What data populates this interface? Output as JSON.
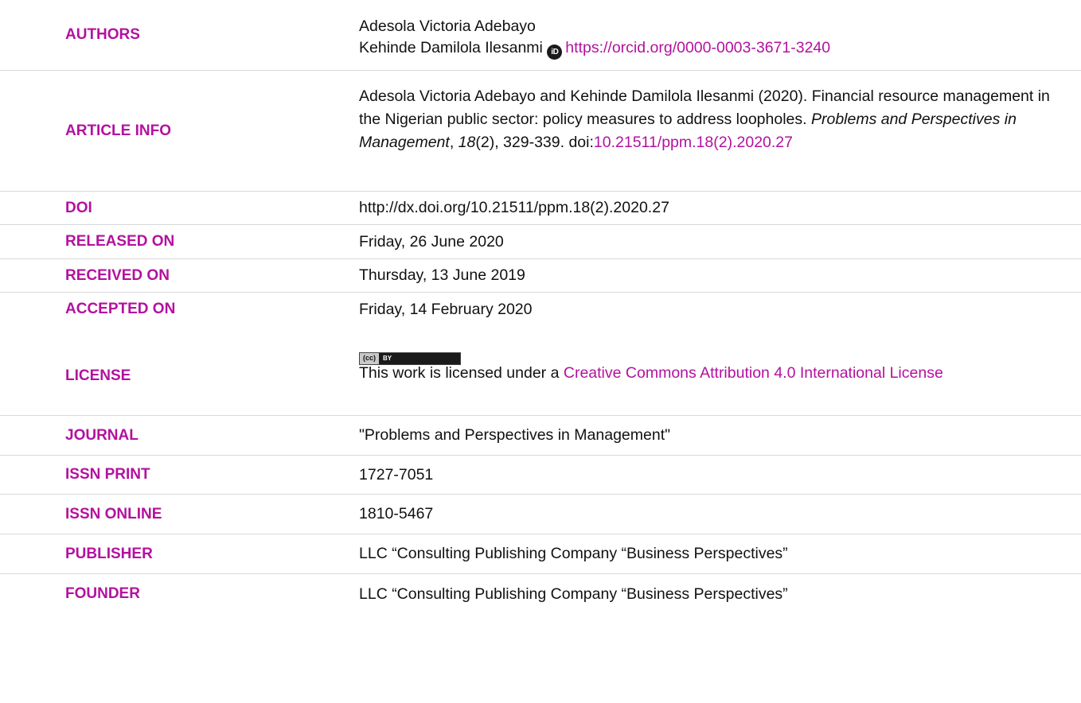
{
  "colors": {
    "label": "#b3119f",
    "link": "#b3119f",
    "divider": "#d9d9d9"
  },
  "authors": {
    "label": "AUTHORS",
    "author1": "Adesola Victoria Adebayo",
    "author2": "Kehinde Damilola Ilesanmi",
    "orcid_icon_text": "iD",
    "orcid_url": "https://orcid.org/0000-0003-3671-3240"
  },
  "article_info": {
    "label": "ARTICLE INFO",
    "citation_part1": "Adesola Victoria Adebayo and Kehinde Damilola Ilesanmi (2020). Financial resource management in the Nigerian public sector: policy measures to address loopholes. ",
    "journal_italic": "Problems and Perspectives in Management",
    "comma": ", ",
    "volume_italic": "18",
    "issue_pages": "(2), 329-339.",
    "doi_prefix": "doi:",
    "doi_link": "10.21511/ppm.18(2).2020.27"
  },
  "doi": {
    "label": "DOI",
    "value": "http://dx.doi.org/10.21511/ppm.18(2).2020.27"
  },
  "released": {
    "label": "RELEASED ON",
    "value": "Friday, 26 June 2020"
  },
  "received": {
    "label": "RECEIVED ON",
    "value": "Thursday, 13 June 2019"
  },
  "accepted": {
    "label": "ACCEPTED ON",
    "value": "Friday, 14 February 2020"
  },
  "license": {
    "label": "LICENSE",
    "badge_cc": "(cc)",
    "badge_by": "BY",
    "text": "This work is licensed under a ",
    "link": "Creative Commons Attribution 4.0 International License"
  },
  "journal": {
    "label": "JOURNAL",
    "value": "\"Problems and Perspectives in Management\""
  },
  "issn_print": {
    "label": "ISSN PRINT",
    "value": "1727-7051"
  },
  "issn_online": {
    "label": "ISSN ONLINE",
    "value": "1810-5467"
  },
  "publisher": {
    "label": "PUBLISHER",
    "value": "LLC “Consulting Publishing Company “Business Perspectives”"
  },
  "founder": {
    "label": "FOUNDER",
    "value": "LLC “Consulting Publishing Company “Business Perspectives”"
  }
}
